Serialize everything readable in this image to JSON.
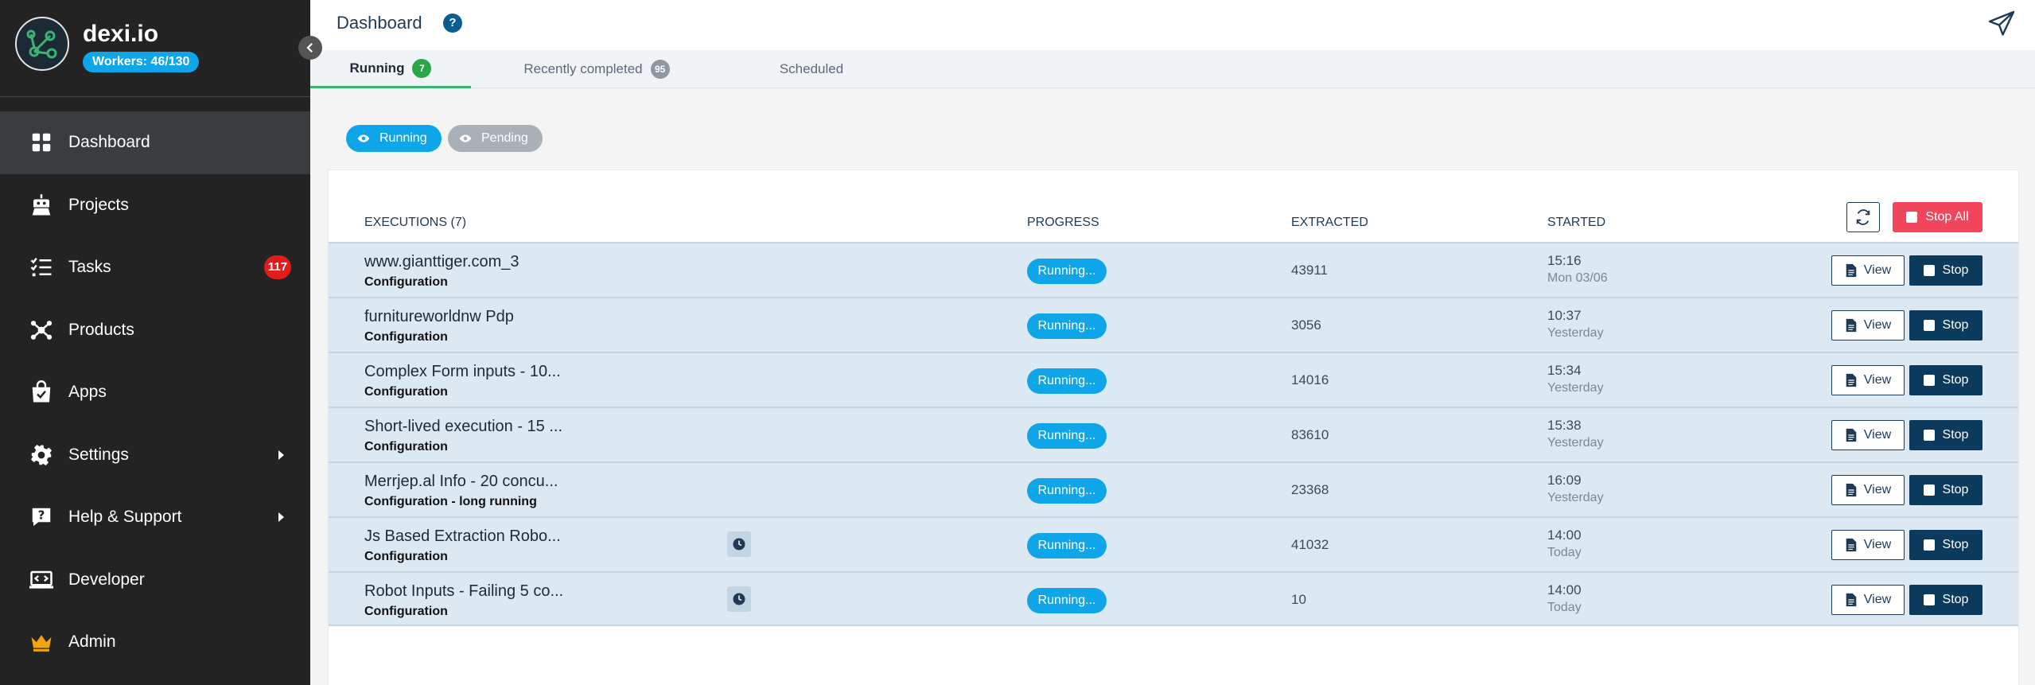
{
  "brand": {
    "name": "dexi.io",
    "workers": "Workers: 46/130"
  },
  "nav": {
    "items": [
      {
        "label": "Dashboard",
        "icon": "dashboard-icon",
        "active": true
      },
      {
        "label": "Projects",
        "icon": "robot-icon"
      },
      {
        "label": "Tasks",
        "icon": "tasks-icon",
        "badge": "117"
      },
      {
        "label": "Products",
        "icon": "products-icon"
      },
      {
        "label": "Apps",
        "icon": "apps-icon"
      },
      {
        "label": "Settings",
        "icon": "gear-icon",
        "submenu": true
      },
      {
        "label": "Help & Support",
        "icon": "help-icon",
        "submenu": true
      },
      {
        "label": "Developer",
        "icon": "developer-icon"
      },
      {
        "label": "Admin",
        "icon": "crown-icon"
      }
    ]
  },
  "header": {
    "title": "Dashboard",
    "help": "?"
  },
  "tabs": [
    {
      "label": "Running",
      "count": "7",
      "active": true
    },
    {
      "label": "Recently completed",
      "count": "95"
    },
    {
      "label": "Scheduled"
    }
  ],
  "filters": {
    "running": "Running",
    "pending": "Pending"
  },
  "table": {
    "headers": {
      "executions": "EXECUTIONS (7)",
      "progress": "PROGRESS",
      "extracted": "EXTRACTED",
      "started": "STARTED"
    },
    "stop_all": "Stop All",
    "view_label": "View",
    "stop_label": "Stop",
    "rows": [
      {
        "name": "www.gianttiger.com_3",
        "sub": "Configuration",
        "progress": "Running...",
        "extracted": "43911",
        "time": "15:16",
        "date": "Mon 03/06",
        "scheduled": false
      },
      {
        "name": "furnitureworldnw Pdp",
        "sub": "Configuration",
        "progress": "Running...",
        "extracted": "3056",
        "time": "10:37",
        "date": "Yesterday",
        "scheduled": false
      },
      {
        "name": "Complex Form inputs - 10...",
        "sub": "Configuration",
        "progress": "Running...",
        "extracted": "14016",
        "time": "15:34",
        "date": "Yesterday",
        "scheduled": false
      },
      {
        "name": "Short-lived execution - 15 ...",
        "sub": "Configuration",
        "progress": "Running...",
        "extracted": "83610",
        "time": "15:38",
        "date": "Yesterday",
        "scheduled": false
      },
      {
        "name": "Merrjep.al Info - 20 concu...",
        "sub": "Configuration - long running",
        "progress": "Running...",
        "extracted": "23368",
        "time": "16:09",
        "date": "Yesterday",
        "scheduled": false
      },
      {
        "name": "Js Based Extraction Robo...",
        "sub": "Configuration",
        "progress": "Running...",
        "extracted": "41032",
        "time": "14:00",
        "date": "Today",
        "scheduled": true
      },
      {
        "name": "Robot Inputs - Failing 5 co...",
        "sub": "Configuration",
        "progress": "Running...",
        "extracted": "10",
        "time": "14:00",
        "date": "Today",
        "scheduled": true
      }
    ]
  },
  "colors": {
    "accent": "#0ea5e9",
    "sidebar": "#232323",
    "stop": "#0c3a5c",
    "danger": "#f0455a",
    "success": "#27a745"
  }
}
